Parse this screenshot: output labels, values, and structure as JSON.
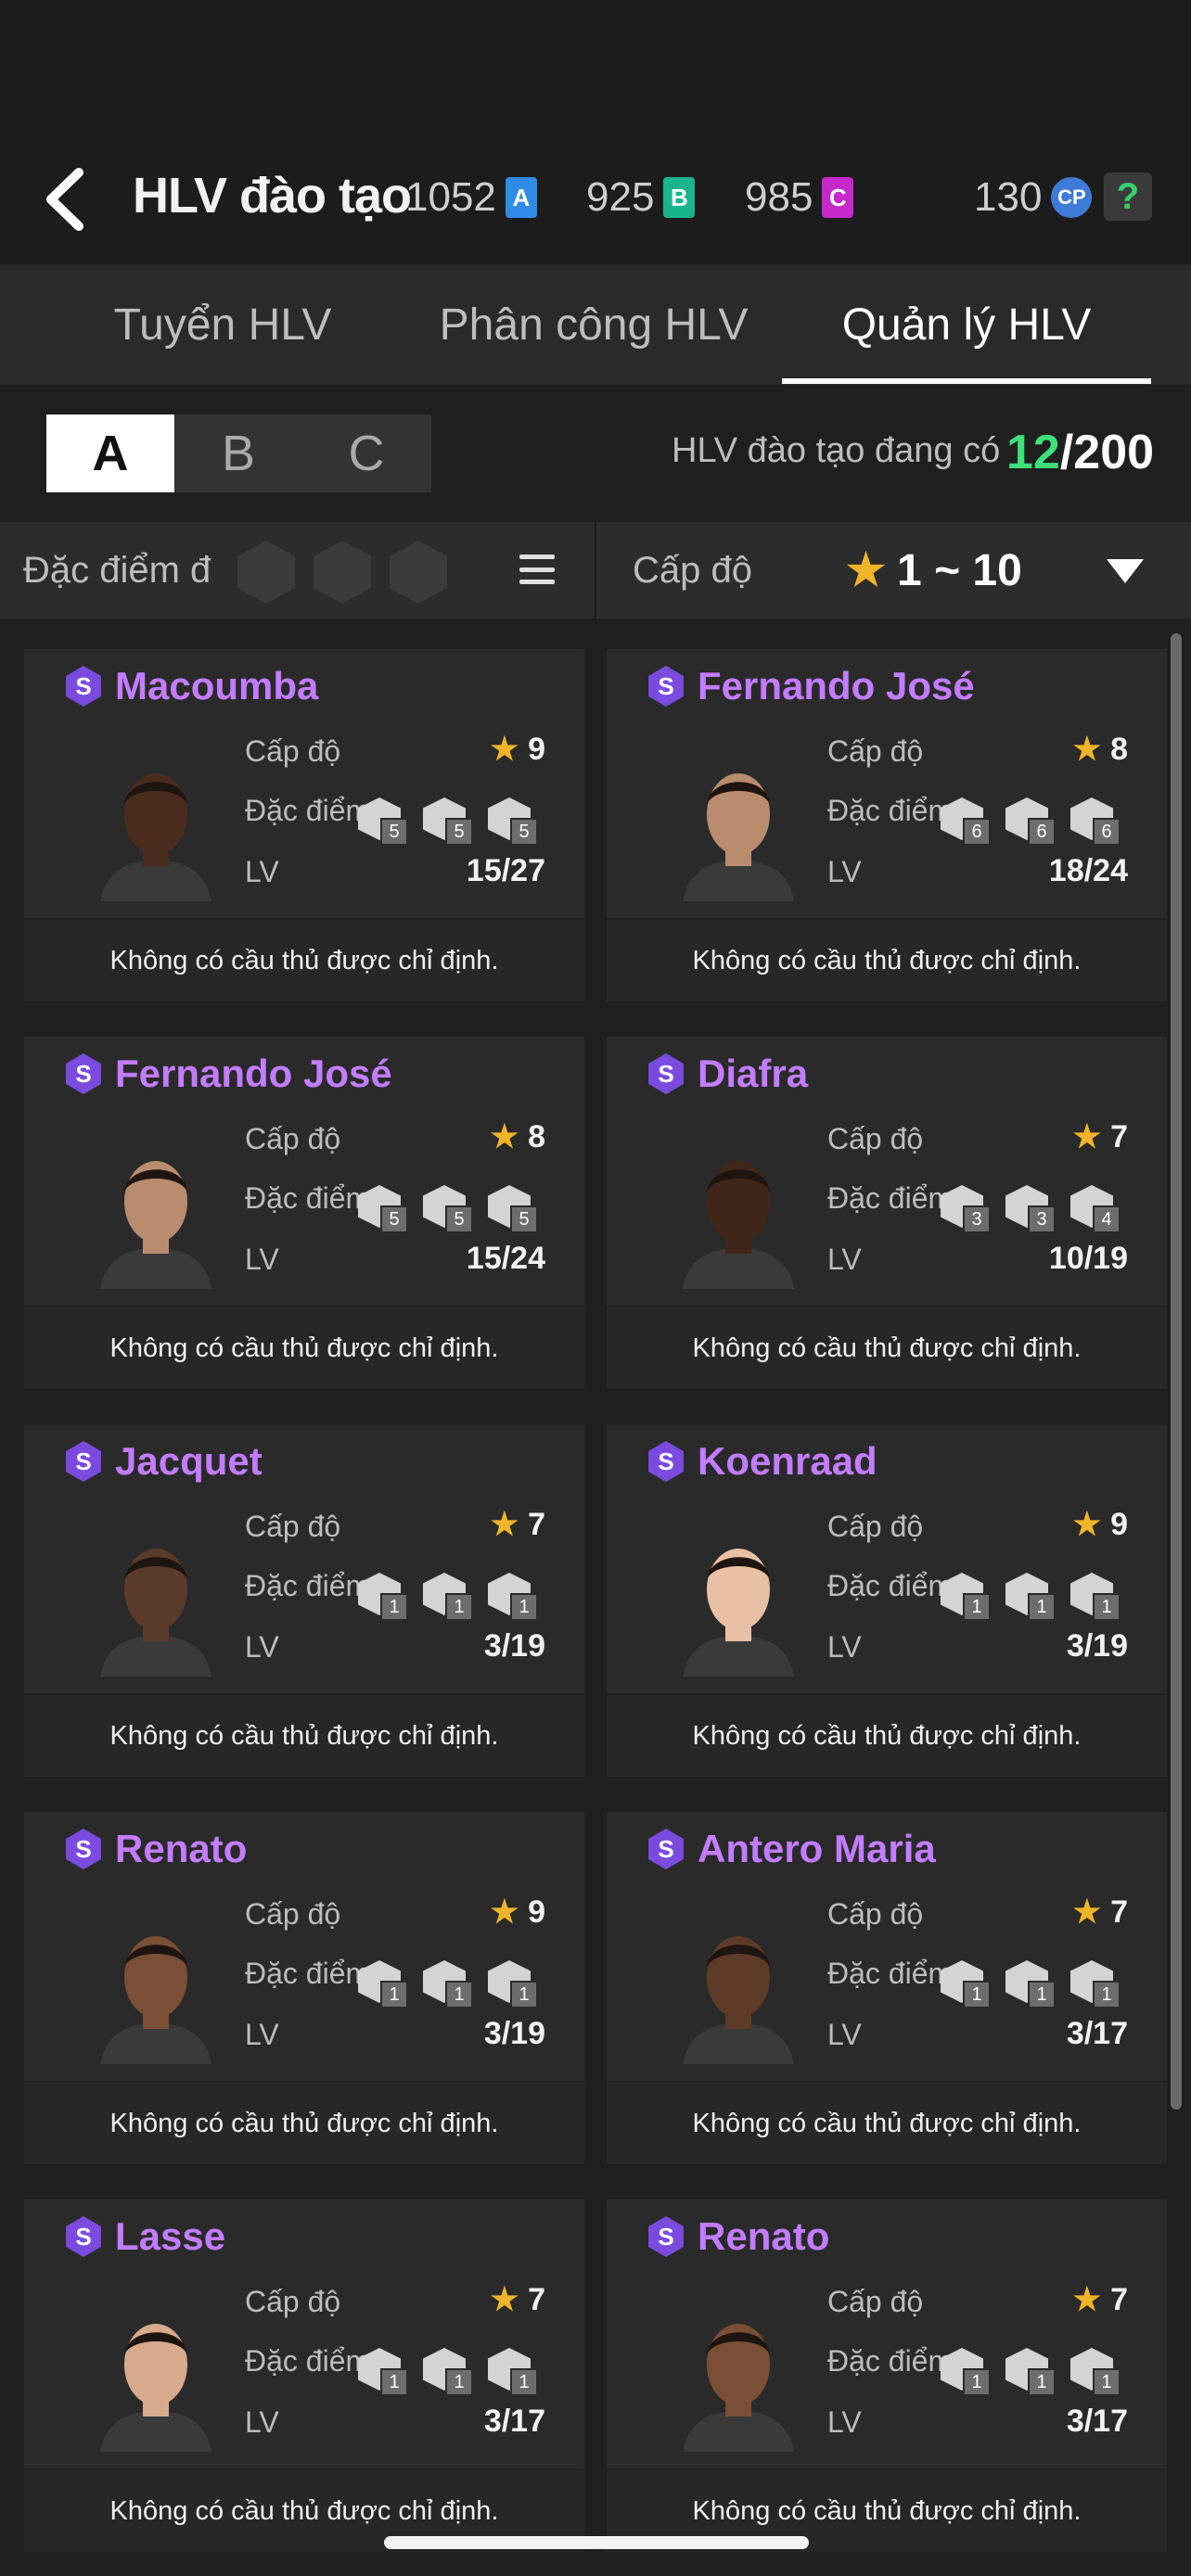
{
  "header": {
    "title": "HLV đào tạo",
    "currencies": [
      {
        "value": "1052",
        "badge": "A",
        "color": "#2f8be6"
      },
      {
        "value": "925",
        "badge": "B",
        "color": "#19b58c"
      },
      {
        "value": "985",
        "badge": "C",
        "color": "#c728c9"
      }
    ],
    "cp": {
      "value": "130",
      "badge": "CP"
    },
    "help": "?"
  },
  "tabs": [
    {
      "label": "Tuyển HLV",
      "active": false
    },
    {
      "label": "Phân công HLV",
      "active": false
    },
    {
      "label": "Quản lý HLV",
      "active": true
    }
  ],
  "groups": [
    {
      "label": "A",
      "active": true
    },
    {
      "label": "B",
      "active": false
    },
    {
      "label": "C",
      "active": false
    }
  ],
  "count": {
    "label": "HLV đào tạo đang có",
    "current": "12",
    "separator": "/",
    "max": "200"
  },
  "filter": {
    "trait_label": "Đặc điểm đ",
    "level_label": "Cấp độ",
    "level_range": "1 ~ 10"
  },
  "card_labels": {
    "level": "Cấp độ",
    "traits": "Đặc điểm",
    "lv": "LV",
    "footer": "Không có cầu thủ được chỉ định."
  },
  "coaches": [
    {
      "name": "Macoumba",
      "tier": "S",
      "level": "9",
      "lv": "15/27",
      "traits": [
        "5",
        "5",
        "5"
      ],
      "skin": "#4a2c1e"
    },
    {
      "name": "Fernando José",
      "tier": "S",
      "level": "8",
      "lv": "18/24",
      "traits": [
        "6",
        "6",
        "6"
      ],
      "skin": "#b98c6e"
    },
    {
      "name": "Fernando José",
      "tier": "S",
      "level": "8",
      "lv": "15/24",
      "traits": [
        "5",
        "5",
        "5"
      ],
      "skin": "#b98c6e"
    },
    {
      "name": "Diafra",
      "tier": "S",
      "level": "7",
      "lv": "10/19",
      "traits": [
        "3",
        "3",
        "4"
      ],
      "skin": "#3f2619"
    },
    {
      "name": "Jacquet",
      "tier": "S",
      "level": "7",
      "lv": "3/19",
      "traits": [
        "1",
        "1",
        "1"
      ],
      "skin": "#5a3a28"
    },
    {
      "name": "Koenraad",
      "tier": "S",
      "level": "9",
      "lv": "3/19",
      "traits": [
        "1",
        "1",
        "1"
      ],
      "skin": "#e8c0a4"
    },
    {
      "name": "Renato",
      "tier": "S",
      "level": "9",
      "lv": "3/19",
      "traits": [
        "1",
        "1",
        "1"
      ],
      "skin": "#7a4f35"
    },
    {
      "name": "Antero Maria",
      "tier": "S",
      "level": "7",
      "lv": "3/17",
      "traits": [
        "1",
        "1",
        "1"
      ],
      "skin": "#5e3b27"
    },
    {
      "name": "Lasse",
      "tier": "S",
      "level": "7",
      "lv": "3/17",
      "traits": [
        "1",
        "1",
        "1"
      ],
      "skin": "#d8aa8c"
    },
    {
      "name": "Renato",
      "tier": "S",
      "level": "7",
      "lv": "3/17",
      "traits": [
        "1",
        "1",
        "1"
      ],
      "skin": "#7a4f35"
    }
  ]
}
